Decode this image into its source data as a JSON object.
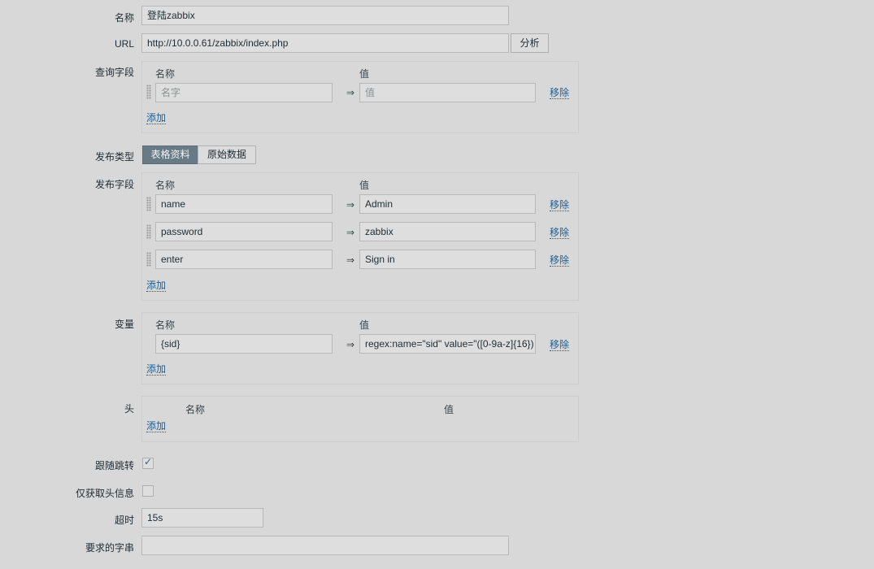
{
  "form": {
    "name_label": "名称",
    "name_value": "登陆zabbix",
    "url_label": "URL",
    "url_value": "http://10.0.0.61/zabbix/index.php",
    "parse_button": "分析",
    "query_label": "查询字段",
    "query": {
      "col_name": "名称",
      "col_value": "值",
      "name_placeholder": "名字",
      "value_placeholder": "值",
      "remove": "移除",
      "add": "添加"
    },
    "post_type_label": "发布类型",
    "post_type_options": [
      "表格资料",
      "原始数据"
    ],
    "post_fields_label": "发布字段",
    "post_fields": {
      "col_name": "名称",
      "col_value": "值",
      "rows": [
        {
          "name": "name",
          "value": "Admin",
          "remove": "移除"
        },
        {
          "name": "password",
          "value": "zabbix",
          "remove": "移除"
        },
        {
          "name": "enter",
          "value": "Sign in",
          "remove": "移除"
        }
      ],
      "add": "添加"
    },
    "variables_label": "变量",
    "variables": {
      "col_name": "名称",
      "col_value": "值",
      "rows": [
        {
          "name": "{sid}",
          "value": "regex:name=\"sid\" value=\"([0-9a-z]{16})",
          "remove": "移除"
        }
      ],
      "add": "添加"
    },
    "headers_label": "头",
    "headers": {
      "col_name": "名称",
      "col_value": "值",
      "add": "添加"
    },
    "follow_redirects_label": "跟随跳转",
    "follow_redirects_checked": true,
    "retrieve_headers_label": "仅获取头信息",
    "retrieve_headers_checked": false,
    "timeout_label": "超时",
    "timeout_value": "15s",
    "required_string_label": "要求的字串",
    "required_string_value": ""
  },
  "icons": {
    "arrow": "⇒",
    "check": "✓"
  }
}
